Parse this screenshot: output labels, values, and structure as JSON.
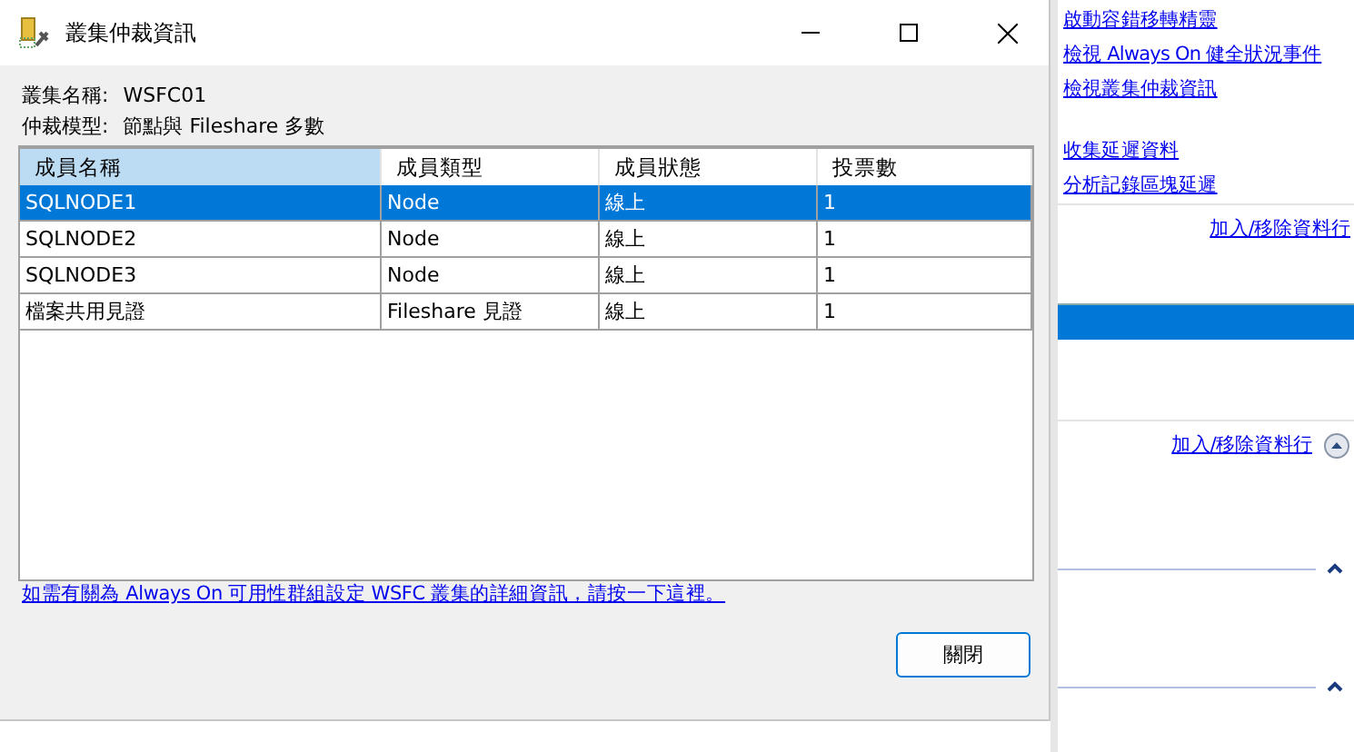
{
  "window": {
    "title": "叢集仲裁資訊"
  },
  "fields": [
    {
      "label": "叢集名稱:",
      "value": "WSFC01"
    },
    {
      "label": "仲裁模型:",
      "value": "節點與 Fileshare 多數"
    }
  ],
  "table": {
    "columns": [
      {
        "label": "成員名稱",
        "sorted": true
      },
      {
        "label": "成員類型",
        "sorted": false
      },
      {
        "label": "成員狀態",
        "sorted": false
      },
      {
        "label": "投票數",
        "sorted": false
      }
    ],
    "rows": [
      {
        "cells": [
          "SQLNODE1",
          "Node",
          "線上",
          "1"
        ],
        "selected": true
      },
      {
        "cells": [
          "SQLNODE2",
          "Node",
          "線上",
          "1"
        ],
        "selected": false
      },
      {
        "cells": [
          "SQLNODE3",
          "Node",
          "線上",
          "1"
        ],
        "selected": false
      },
      {
        "cells": [
          "檔案共用見證",
          "Fileshare 見證",
          "線上",
          "1"
        ],
        "selected": false
      }
    ]
  },
  "help_link": "如需有關為 Always On 可用性群組設定 WSFC 叢集的詳細資訊，請按一下這裡。",
  "buttons": [
    "關閉"
  ],
  "background_panel": {
    "task_links": [
      "啟動容錯移轉精靈",
      "檢視 Always On 健全狀況事件",
      "檢視叢集仲裁資訊"
    ],
    "latency_links": [
      "收集延遲資料",
      "分析記錄區塊延遲"
    ],
    "column_links": [
      "加入/移除資料行",
      "加入/移除資料行"
    ]
  }
}
